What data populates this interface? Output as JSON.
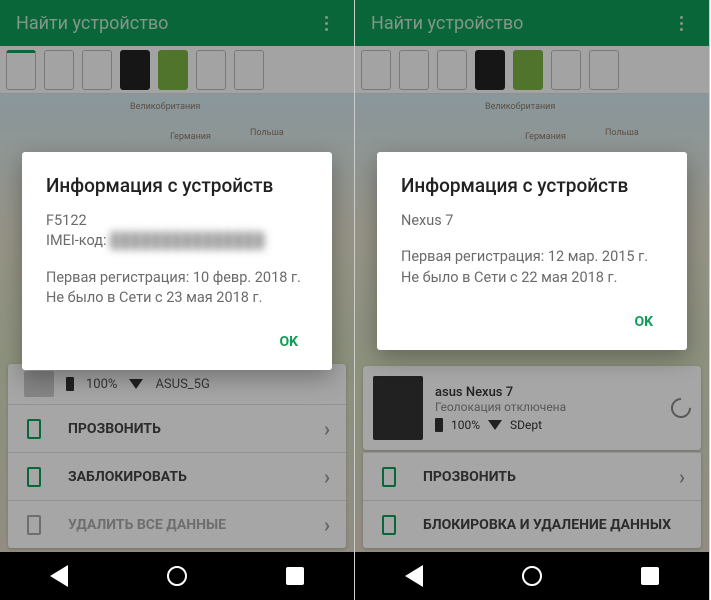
{
  "appTitle": "Найти устройство",
  "left": {
    "dialog": {
      "title": "Информация с устройств",
      "device": "F5122",
      "imeiLabel": "IMEI-код:",
      "imeiValue": "███████████████",
      "reg": "Первая регистрация: 10 февр. 2018 г.",
      "lastSeen": "Не было в Сети с 23 мая 2018 г.",
      "ok": "OK"
    },
    "statsBattery": "100%",
    "statsNet": "ASUS_5G",
    "actions": {
      "ring": "ПРОЗВОНИТЬ",
      "lock": "ЗАБЛОКИРОВАТЬ",
      "erase": "УДАЛИТЬ ВСЕ ДАННЫЕ"
    }
  },
  "right": {
    "dialog": {
      "title": "Информация с устройств",
      "device": "Nexus 7",
      "reg": "Первая регистрация: 12 мар. 2015 г.",
      "lastSeen": "Не было в Сети с 22 мая 2018 г.",
      "ok": "OK"
    },
    "info": {
      "title": "asus Nexus 7",
      "sub": "Геолокация отключена",
      "battery": "100%",
      "net": "SDept"
    },
    "actions": {
      "ring": "ПРОЗВОНИТЬ",
      "lockErase": "БЛОКИРОВКА И УДАЛЕНИЕ ДАННЫХ"
    }
  },
  "mapLabels": {
    "uk": "Великобритания",
    "de": "Германия",
    "pl": "Польша"
  }
}
